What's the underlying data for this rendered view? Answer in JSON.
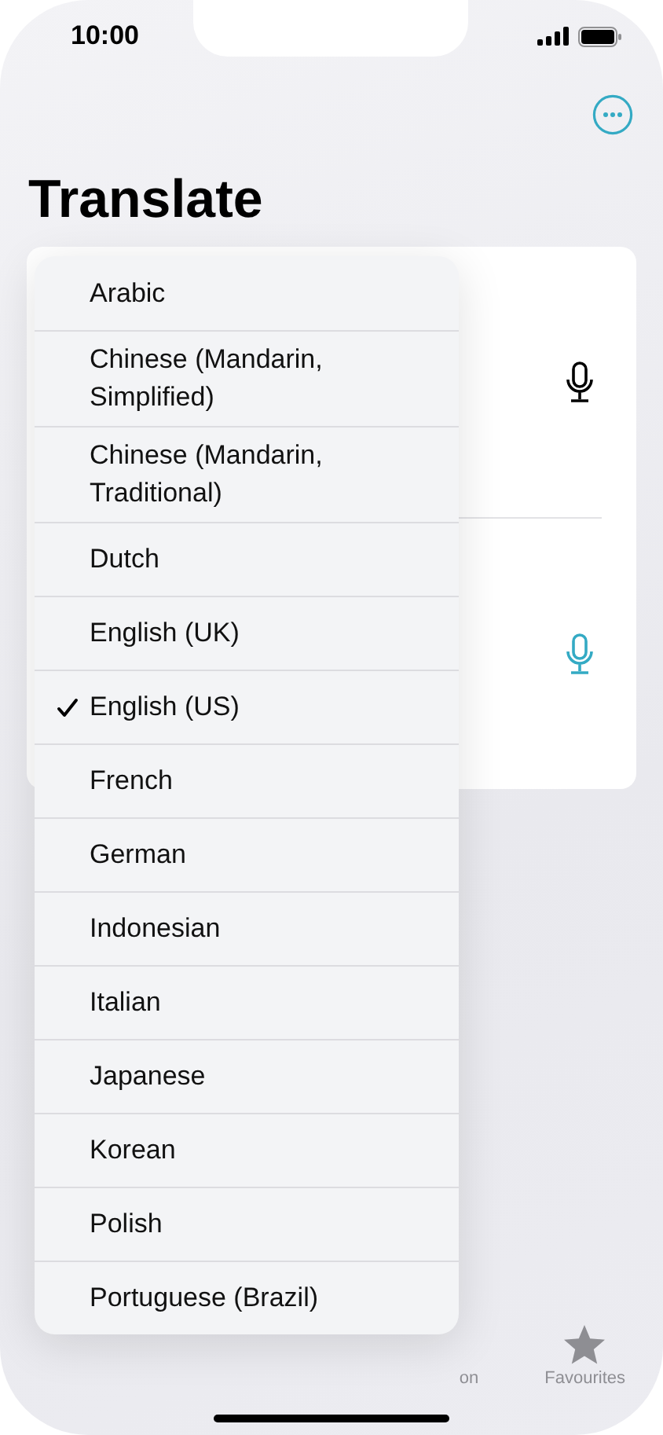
{
  "status_bar": {
    "time": "10:00"
  },
  "title": "Translate",
  "language_menu": [
    {
      "label": "Arabic",
      "selected": false
    },
    {
      "label": "Chinese (Mandarin, Simplified)",
      "selected": false
    },
    {
      "label": "Chinese (Mandarin, Traditional)",
      "selected": false
    },
    {
      "label": "Dutch",
      "selected": false
    },
    {
      "label": "English (UK)",
      "selected": false
    },
    {
      "label": "English (US)",
      "selected": true
    },
    {
      "label": "French",
      "selected": false
    },
    {
      "label": "German",
      "selected": false
    },
    {
      "label": "Indonesian",
      "selected": false
    },
    {
      "label": "Italian",
      "selected": false
    },
    {
      "label": "Japanese",
      "selected": false
    },
    {
      "label": "Korean",
      "selected": false
    },
    {
      "label": "Polish",
      "selected": false
    },
    {
      "label": "Portuguese (Brazil)",
      "selected": false
    }
  ],
  "tab_bar": [
    {
      "label": "on",
      "kind": "partial",
      "selected": false
    },
    {
      "label": "Favourites",
      "kind": "star",
      "selected": false
    }
  ]
}
